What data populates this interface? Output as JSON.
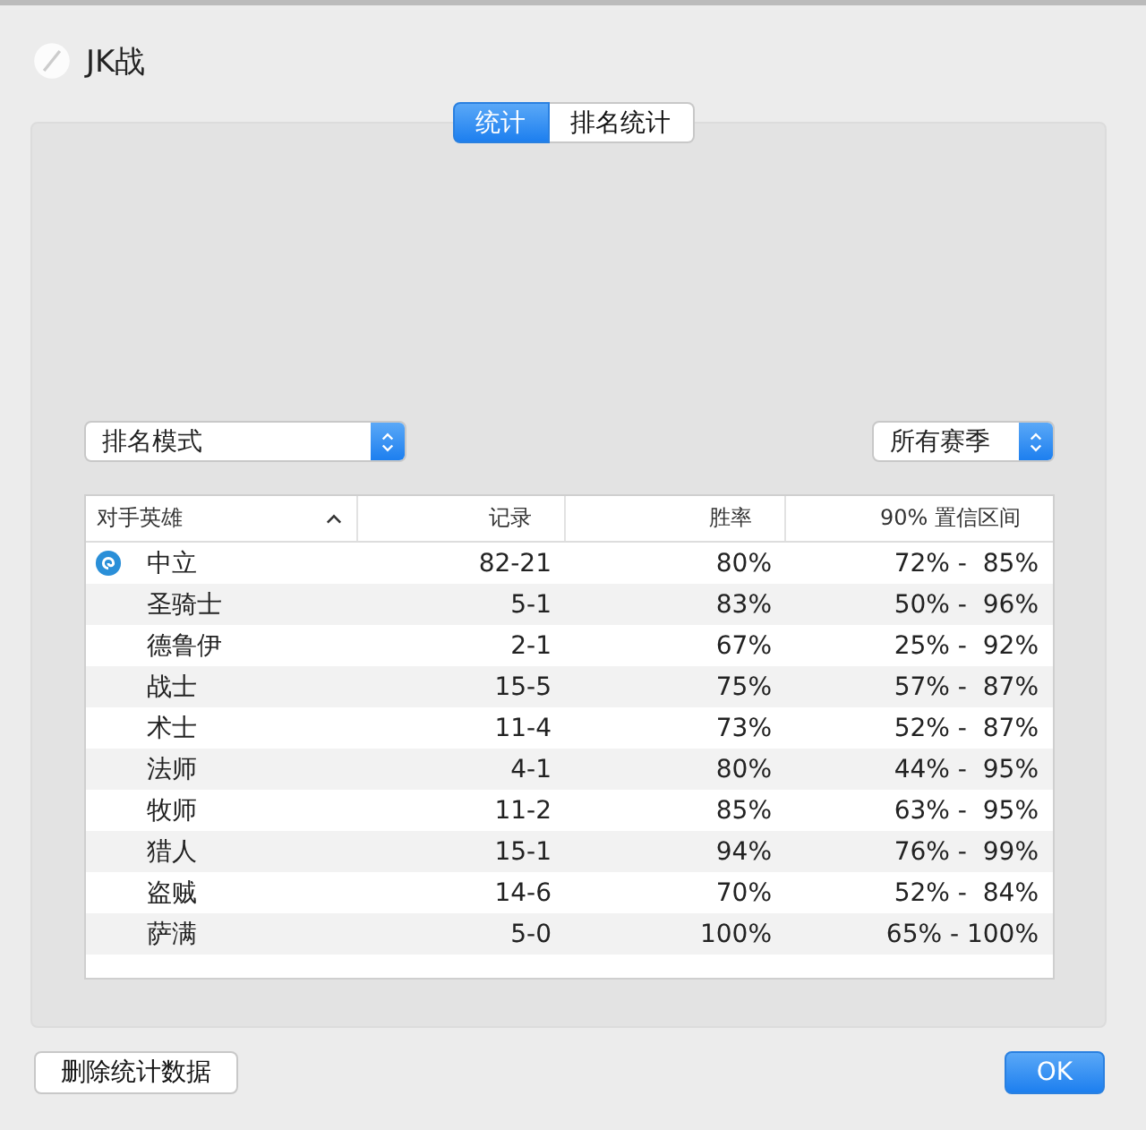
{
  "window": {
    "title": "JK战"
  },
  "tabs": [
    {
      "label": "统计",
      "selected": true
    },
    {
      "label": "排名统计",
      "selected": false
    }
  ],
  "mode_dropdown": {
    "value": "排名模式"
  },
  "season_dropdown": {
    "value": "所有赛季"
  },
  "table": {
    "columns": [
      {
        "label": "对手英雄"
      },
      {
        "label": "记录"
      },
      {
        "label": "胜率"
      },
      {
        "label": "90% 置信区间"
      }
    ],
    "rows": [
      {
        "hero": "中立",
        "record": "82-21",
        "win_rate": "80%",
        "interval": "72% -  85%"
      },
      {
        "hero": "圣骑士",
        "record": "5-1",
        "win_rate": "83%",
        "interval": "50% -  96%"
      },
      {
        "hero": "德鲁伊",
        "record": "2-1",
        "win_rate": "67%",
        "interval": "25% -  92%"
      },
      {
        "hero": "战士",
        "record": "15-5",
        "win_rate": "75%",
        "interval": "57% -  87%"
      },
      {
        "hero": "术士",
        "record": "11-4",
        "win_rate": "73%",
        "interval": "52% -  87%"
      },
      {
        "hero": "法师",
        "record": "4-1",
        "win_rate": "80%",
        "interval": "44% -  95%"
      },
      {
        "hero": "牧师",
        "record": "11-2",
        "win_rate": "85%",
        "interval": "63% -  95%"
      },
      {
        "hero": "猎人",
        "record": "15-1",
        "win_rate": "94%",
        "interval": "76% -  99%"
      },
      {
        "hero": "盗贼",
        "record": "14-6",
        "win_rate": "70%",
        "interval": "52% -  84%"
      },
      {
        "hero": "萨满",
        "record": "5-0",
        "win_rate": "100%",
        "interval": "65% - 100%"
      }
    ]
  },
  "buttons": [
    {
      "label": "删除统计数据",
      "kind": "plain"
    },
    {
      "label": "OK",
      "kind": "default"
    }
  ]
}
